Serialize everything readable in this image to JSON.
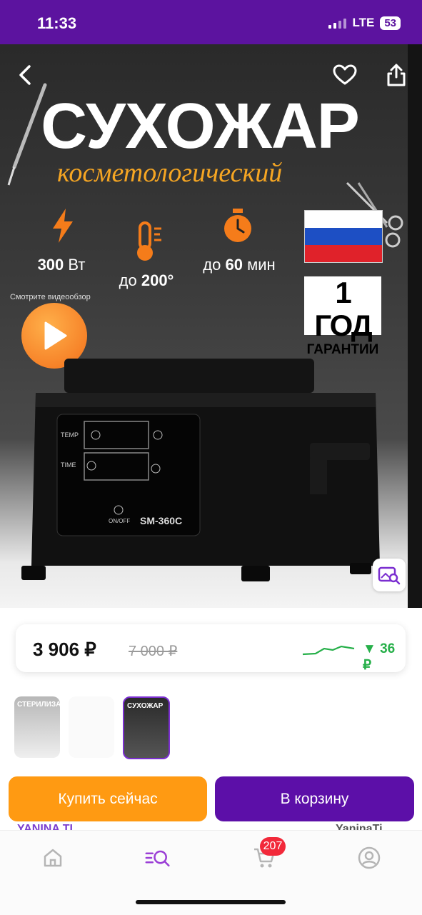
{
  "status_bar": {
    "time": "11:33",
    "network": "LTE",
    "battery": "53"
  },
  "hero": {
    "title": "СУХОЖАР",
    "subtitle": "косметологический",
    "features": [
      {
        "icon": "lightning-icon",
        "value": "300",
        "unit": "Вт",
        "prefix": ""
      },
      {
        "icon": "thermometer-icon",
        "value": "200°",
        "unit": "",
        "prefix": "до"
      },
      {
        "icon": "stopwatch-icon",
        "value": "60",
        "unit": "мин",
        "prefix": "до"
      }
    ],
    "warranty": {
      "big": "1 ГОД",
      "small": "ГАРАНТИИ"
    },
    "video_ring_text": "Смотрите видеообзор",
    "device": {
      "temp_label": "TEMP",
      "time_label": "TIME",
      "power_label": "ON/OFF",
      "model": "SM-360C"
    }
  },
  "price": {
    "current": "3 906 ₽",
    "old": "7 000 ₽",
    "delta": "▼ 36 ₽",
    "delta_color": "#27b04a"
  },
  "thumbnails": [
    {
      "label": "СТЕРИЛИЗАТОР",
      "selected": false
    },
    {
      "label": "",
      "selected": false
    },
    {
      "label": "СУХОЖАР",
      "selected": true
    }
  ],
  "actions": {
    "buy_now": "Купить сейчас",
    "add_to_cart": "В корзину"
  },
  "peek_text": {
    "left": "YANINA TI",
    "right": "YaninaTi"
  },
  "tabbar": {
    "cart_badge": "207"
  },
  "colors": {
    "brand": "#5c139f",
    "buy": "#ff9a12",
    "cart": "#5c0fa8"
  }
}
